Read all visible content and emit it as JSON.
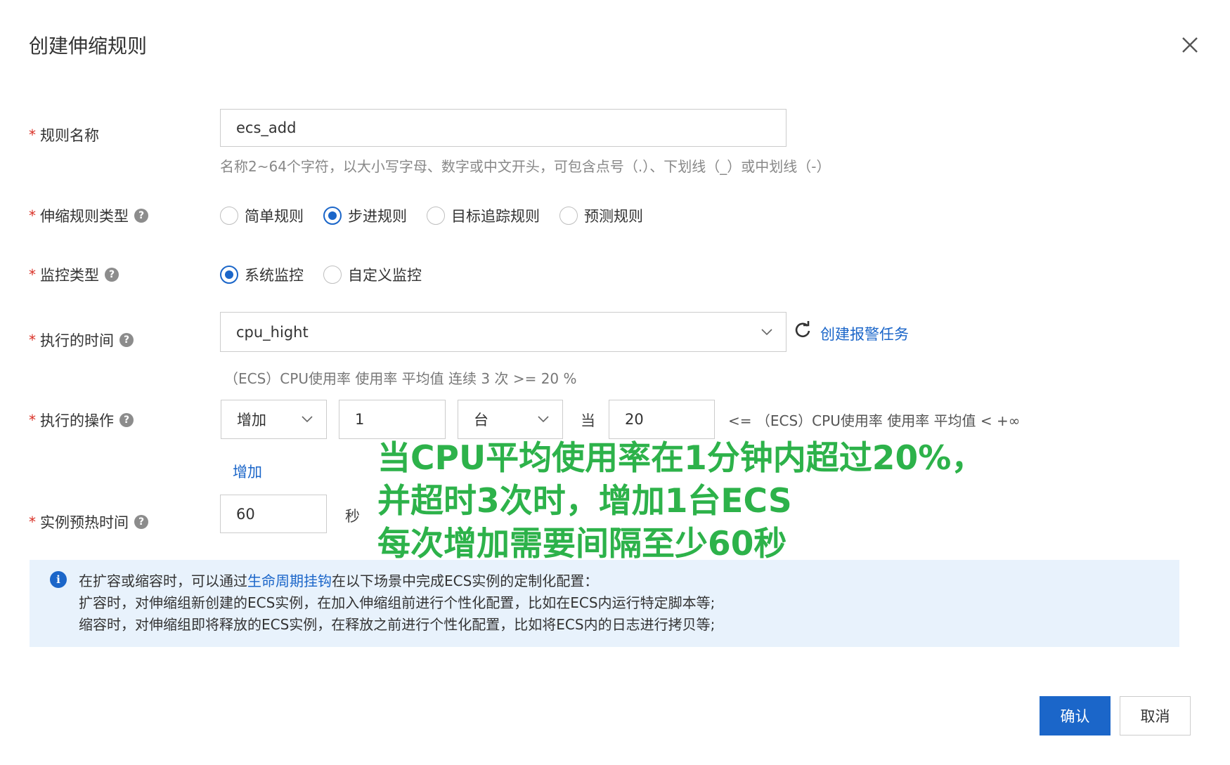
{
  "dialog": {
    "title": "创建伸缩规则",
    "close_icon": "close-icon"
  },
  "form": {
    "rule_name": {
      "required": "*",
      "label": "规则名称",
      "value": "ecs_add",
      "hint": "名称2~64个字符，以大小写字母、数字或中文开头，可包含点号（.）、下划线（_）或中划线（-）"
    },
    "rule_type": {
      "required": "*",
      "label": "伸缩规则类型",
      "help_icon": "help-icon",
      "options": [
        "简单规则",
        "步进规则",
        "目标追踪规则",
        "预测规则"
      ],
      "selected": "步进规则"
    },
    "monitor_type": {
      "required": "*",
      "label": "监控类型",
      "help_icon": "help-icon",
      "options": [
        "系统监控",
        "自定义监控"
      ],
      "selected": "系统监控"
    },
    "exec_time": {
      "required": "*",
      "label": "执行的时间",
      "help_icon": "help-icon",
      "value": "cpu_hight",
      "create_alarm_link": "创建报警任务",
      "refresh_icon": "refresh-icon",
      "description": "（ECS）CPU使用率 使用率 平均值 连续 3 次 >= 20 %"
    },
    "exec_action": {
      "required": "*",
      "label": "执行的操作",
      "help_icon": "help-icon",
      "operation": "增加",
      "amount": "1",
      "unit": "台",
      "when_label": "当",
      "threshold": "20",
      "condition_text": "<= （ECS）CPU使用率   使用率 平均值   < +∞",
      "add_link": "增加"
    },
    "warmup": {
      "required": "*",
      "label": "实例预热时间",
      "help_icon": "help-icon",
      "value": "60",
      "unit": "秒"
    }
  },
  "annotation": {
    "line1": "当CPU平均使用率在1分钟内超过20%，",
    "line2": "并超时3次时，增加1台ECS",
    "line3": "每次增加需要间隔至少60秒",
    "color": "#2db24a"
  },
  "info": {
    "icon": "info-icon",
    "line1_prefix": "在扩容或缩容时，可以通过",
    "line1_link": "生命周期挂钩",
    "line1_suffix": "在以下场景中完成ECS实例的定制化配置：",
    "line2": "扩容时，对伸缩组新创建的ECS实例，在加入伸缩组前进行个性化配置，比如在ECS内运行特定脚本等;",
    "line3": "缩容时，对伸缩组即将释放的ECS实例，在释放之前进行个性化配置，比如将ECS内的日志进行拷贝等;"
  },
  "footer": {
    "confirm": "确认",
    "cancel": "取消"
  },
  "colors": {
    "primary": "#1b66c9",
    "required": "#d93026",
    "info_bg": "#e8f2fc"
  }
}
